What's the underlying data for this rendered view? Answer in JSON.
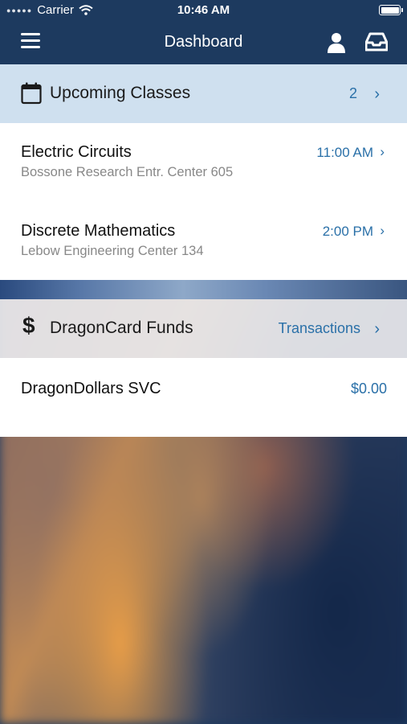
{
  "status_bar": {
    "carrier": "Carrier",
    "time": "10:46 AM"
  },
  "nav": {
    "title": "Dashboard"
  },
  "upcoming_classes": {
    "title": "Upcoming Classes",
    "count": "2",
    "items": [
      {
        "name": "Electric Circuits",
        "location": "Bossone Research Entr. Center 605",
        "time": "11:00 AM"
      },
      {
        "name": "Discrete Mathematics",
        "location": "Lebow Engineering Center 134",
        "time": "2:00 PM"
      }
    ]
  },
  "dragoncard": {
    "title": "DragonCard Funds",
    "link": "Transactions",
    "items": [
      {
        "name": "DragonDollars SVC",
        "balance": "$0.00"
      }
    ]
  },
  "icons": [
    "menu-icon",
    "user-icon",
    "inbox-icon",
    "calendar-icon",
    "dollar-icon",
    "chevron-right-icon",
    "wifi-icon",
    "battery-icon"
  ],
  "colors": {
    "nav_background": "#1d3a5f",
    "accent": "#2a70a8",
    "classes_header_bg": "#cfe0ef"
  }
}
